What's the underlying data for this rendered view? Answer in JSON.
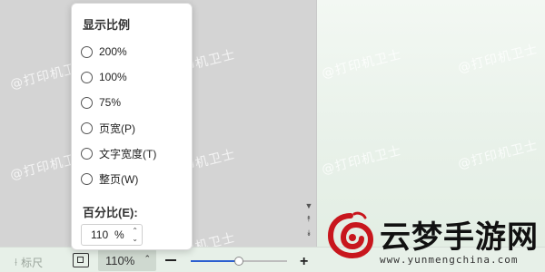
{
  "watermark_text": "@打印机卫士",
  "popup": {
    "title": "显示比例",
    "options": [
      {
        "label": "200%"
      },
      {
        "label": "100%"
      },
      {
        "label": "75%"
      },
      {
        "label": "页宽(P)"
      },
      {
        "label": "文字宽度(T)"
      },
      {
        "label": "整页(W)"
      }
    ],
    "percent_label": "百分比(E):",
    "percent_value": "110",
    "percent_unit": "%"
  },
  "statusbar": {
    "ruler_label": "标尺",
    "zoom_value": "110%",
    "zoom_level": 0.5
  },
  "logo": {
    "name": "云梦手游网",
    "url": "www.yunmengchina.com"
  }
}
